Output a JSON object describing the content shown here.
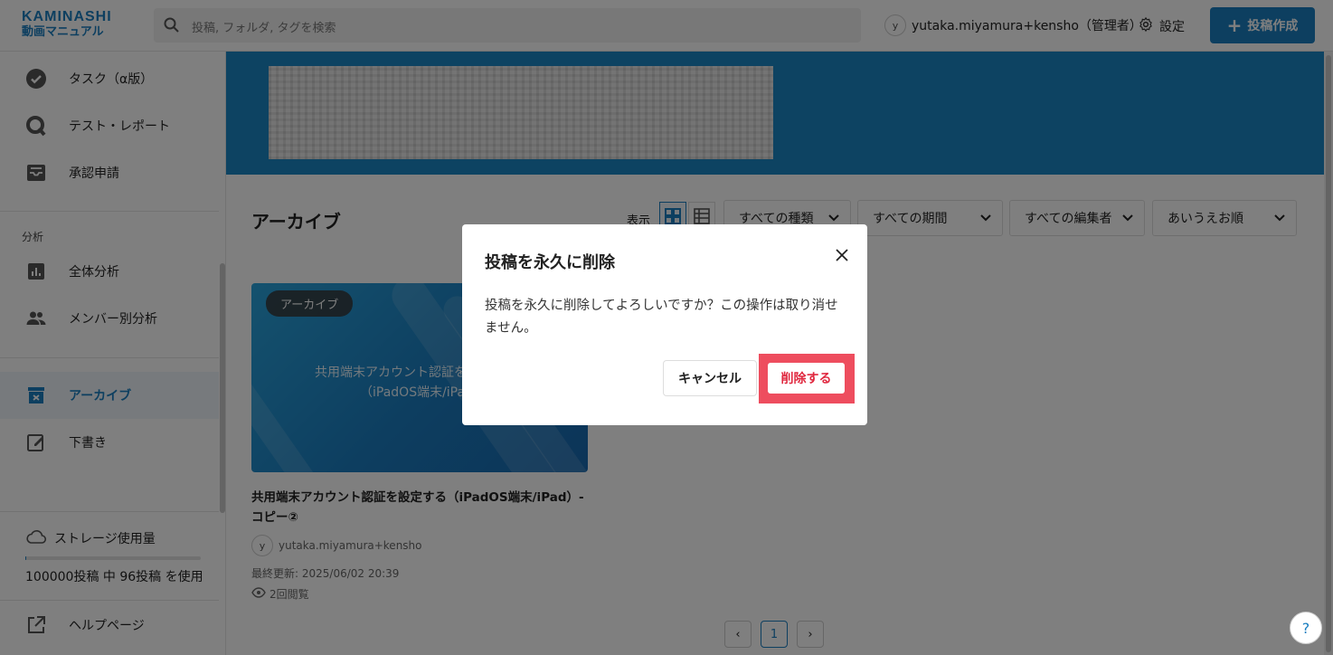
{
  "app": {
    "logo_line1": "KAMINASHI",
    "logo_line2": "動画マニュアル",
    "accent_color": "#1b7fc1"
  },
  "header": {
    "search_placeholder": "投稿, フォルダ, タグを検索",
    "user_initial": "y",
    "user_name": "yutaka.miyamura+kensho（管理者）",
    "settings_label": "設定",
    "create_label": "投稿作成"
  },
  "sidebar": {
    "items_top": [
      {
        "label": "タスク（α版）",
        "icon": "check-circle-icon"
      },
      {
        "label": "テスト・レポート",
        "icon": "quiz-icon"
      },
      {
        "label": "承認申請",
        "icon": "inbox-icon"
      }
    ],
    "analysis_title": "分析",
    "items_analysis": [
      {
        "label": "全体分析",
        "icon": "bar-chart-icon"
      },
      {
        "label": "メンバー別分析",
        "icon": "people-icon"
      }
    ],
    "items_bottom": [
      {
        "label": "アーカイブ",
        "icon": "archive-icon",
        "active": true
      },
      {
        "label": "下書き",
        "icon": "edit-icon"
      }
    ],
    "storage_label": "ストレージ使用量",
    "storage_text": "100000投稿 中 96投稿 を使用",
    "storage_used_fraction": 0.00096,
    "help_label": "ヘルプページ"
  },
  "main": {
    "title": "アーカイブ",
    "view_label": "表示",
    "filters": [
      "すべての種類",
      "すべての期間",
      "すべての編集者",
      "あいうえお順"
    ],
    "card": {
      "badge": "アーカイブ",
      "thumb_line1": "共用端末アカウント認証を",
      "thumb_line2": "（iPadOS端末/iPa",
      "title": "共用端末アカウント認証を設定する（iPadOS端末/iPad）- コピー②",
      "author_initial": "y",
      "author": "yutaka.miyamura+kensho",
      "updated": "最終更新: 2025/06/02 20:39",
      "views": "2回閲覧"
    },
    "pagination": {
      "prev": "‹",
      "current": "1",
      "next": "›"
    }
  },
  "modal": {
    "title": "投稿を永久に削除",
    "body": "投稿を永久に削除してよろしいですか？この操作は取り消せません。",
    "cancel_label": "キャンセル",
    "delete_label": "削除する",
    "delete_color": "#e0283f"
  },
  "help_fab": "?"
}
